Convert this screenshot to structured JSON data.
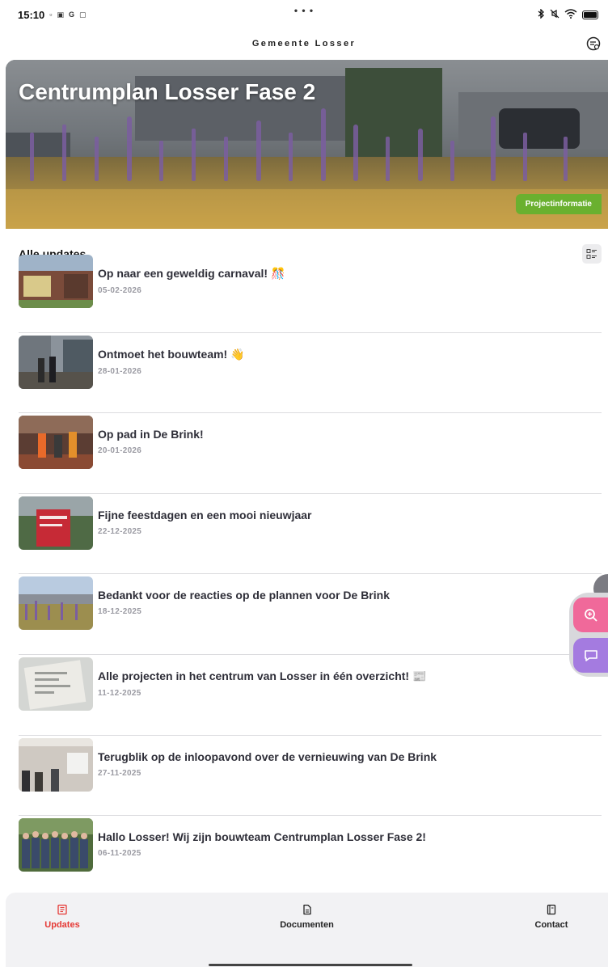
{
  "status_bar": {
    "time": "15:10",
    "mini_icons": [
      "▫",
      "▣",
      "G",
      "▢"
    ],
    "center_dots": "• • •"
  },
  "app": {
    "title": "Gemeente Losser"
  },
  "hero": {
    "title": "Centrumplan Losser Fase 2",
    "button_label": "Projectinformatie"
  },
  "section": {
    "title": "Alle updates"
  },
  "updates": [
    {
      "title": "Op naar een geweldig carnaval! 🎊",
      "date": "05-02-2026"
    },
    {
      "title": "Ontmoet het bouwteam! 👋",
      "date": "28-01-2026"
    },
    {
      "title": "Op pad in De Brink!",
      "date": "20-01-2026"
    },
    {
      "title": "Fijne feestdagen en een mooi nieuwjaar",
      "date": "22-12-2025"
    },
    {
      "title": "Bedankt voor de reacties op de plannen voor De Brink",
      "date": "18-12-2025"
    },
    {
      "title": "Alle projecten in het centrum van Losser in één overzicht! 📰",
      "date": "11-12-2025"
    },
    {
      "title": "Terugblik op de inloopavond over de vernieuwing van De Brink",
      "date": "27-11-2025"
    },
    {
      "title": "Hallo Losser! Wij zijn bouwteam Centrumplan Losser Fase 2!",
      "date": "06-11-2025"
    }
  ],
  "nav": {
    "items": [
      {
        "label": "Updates",
        "icon": "news-icon",
        "active": true
      },
      {
        "label": "Documenten",
        "icon": "document-icon",
        "active": false
      },
      {
        "label": "Contact",
        "icon": "contact-book-icon",
        "active": false
      }
    ]
  },
  "colors": {
    "accent_green": "#6ab02f",
    "active_red": "#e53935",
    "fab_pink": "#f0699a",
    "fab_purple": "#a47be0"
  }
}
